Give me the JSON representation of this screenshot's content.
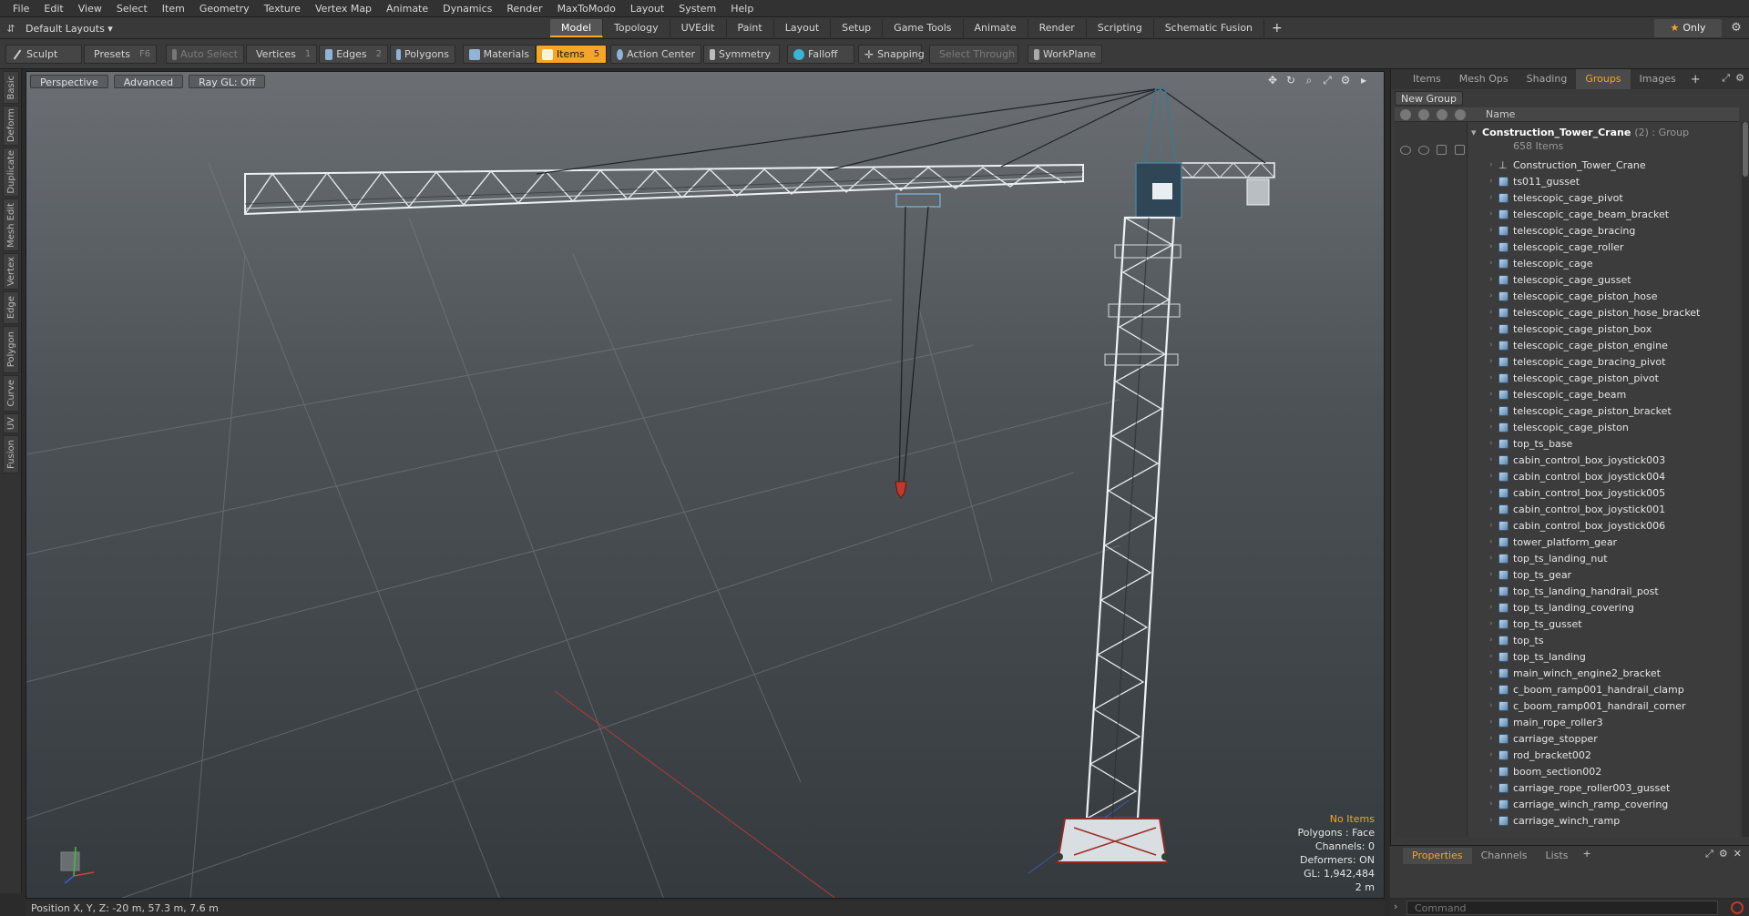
{
  "menu": [
    "File",
    "Edit",
    "View",
    "Select",
    "Item",
    "Geometry",
    "Texture",
    "Vertex Map",
    "Animate",
    "Dynamics",
    "Render",
    "MaxToModo",
    "Layout",
    "System",
    "Help"
  ],
  "layout": {
    "preset": "Default Layouts ▾",
    "tabs": [
      "Model",
      "Topology",
      "UVEdit",
      "Paint",
      "Layout",
      "Setup",
      "Game Tools",
      "Animate",
      "Render",
      "Scripting",
      "Schematic Fusion"
    ],
    "active_tab": "Model",
    "only_label": "Only",
    "only_star": "★"
  },
  "toolbar": {
    "sculpt": "Sculpt",
    "presets": "Presets",
    "presets_key": "F6",
    "auto_select": "Auto Select",
    "vertices": "Vertices",
    "vertices_key": "1",
    "edges": "Edges",
    "edges_key": "2",
    "polygons": "Polygons",
    "materials": "Materials",
    "items": "Items",
    "items_key": "5",
    "action_center": "Action Center",
    "symmetry": "Symmetry",
    "falloff": "Falloff",
    "snapping": "Snapping",
    "select_through": "Select Through",
    "workplane": "WorkPlane"
  },
  "left_tabs": [
    "Basic",
    "Deform",
    "Duplicate",
    "Mesh Edit",
    "Vertex",
    "Edge",
    "Polygon",
    "Curve",
    "UV",
    "Fusion"
  ],
  "viewport": {
    "perspective": "Perspective",
    "advanced": "Advanced",
    "raygl": "Ray GL: Off",
    "hud": {
      "no_items": "No Items",
      "polygons": "Polygons : Face",
      "channels": "Channels: 0",
      "deformers": "Deformers: ON",
      "gl": "GL: 1,942,484",
      "scale": "2 m"
    }
  },
  "status": {
    "position": "Position X, Y, Z:  -20 m, 57.3 m, 7.6 m"
  },
  "panel": {
    "tabs": [
      "Items",
      "Mesh Ops",
      "Shading",
      "Groups",
      "Images"
    ],
    "active_tab": "Groups",
    "new_group": "New Group",
    "name_header": "Name",
    "group_name": "Construction_Tower_Crane",
    "group_meta": "(2) : Group",
    "group_count": "658 Items",
    "items": [
      "Construction_Tower_Crane",
      "ts011_gusset",
      "telescopic_cage_pivot",
      "telescopic_cage_beam_bracket",
      "telescopic_cage_bracing",
      "telescopic_cage_roller",
      "telescopic_cage",
      "telescopic_cage_gusset",
      "telescopic_cage_piston_hose",
      "telescopic_cage_piston_hose_bracket",
      "telescopic_cage_piston_box",
      "telescopic_cage_piston_engine",
      "telescopic_cage_bracing_pivot",
      "telescopic_cage_piston_pivot",
      "telescopic_cage_beam",
      "telescopic_cage_piston_bracket",
      "telescopic_cage_piston",
      "top_ts_base",
      "cabin_control_box_joystick003",
      "cabin_control_box_joystick004",
      "cabin_control_box_joystick005",
      "cabin_control_box_joystick001",
      "cabin_control_box_joystick006",
      "tower_platform_gear",
      "top_ts_landing_nut",
      "top_ts_gear",
      "top_ts_landing_handrail_post",
      "top_ts_landing_covering",
      "top_ts_gusset",
      "top_ts",
      "top_ts_landing",
      "main_winch_engine2_bracket",
      "c_boom_ramp001_handrail_clamp",
      "c_boom_ramp001_handrail_corner",
      "main_rope_roller3",
      "carriage_stopper",
      "rod_bracket002",
      "boom_section002",
      "carriage_rope_roller003_gusset",
      "carriage_winch_ramp_covering",
      "carriage_winch_ramp"
    ]
  },
  "properties": {
    "tabs": [
      "Properties",
      "Channels",
      "Lists"
    ],
    "active_tab": "Properties"
  },
  "command": {
    "placeholder": "Command"
  },
  "colors": {
    "accent": "#f5a623",
    "crane_red": "#c0392b"
  }
}
